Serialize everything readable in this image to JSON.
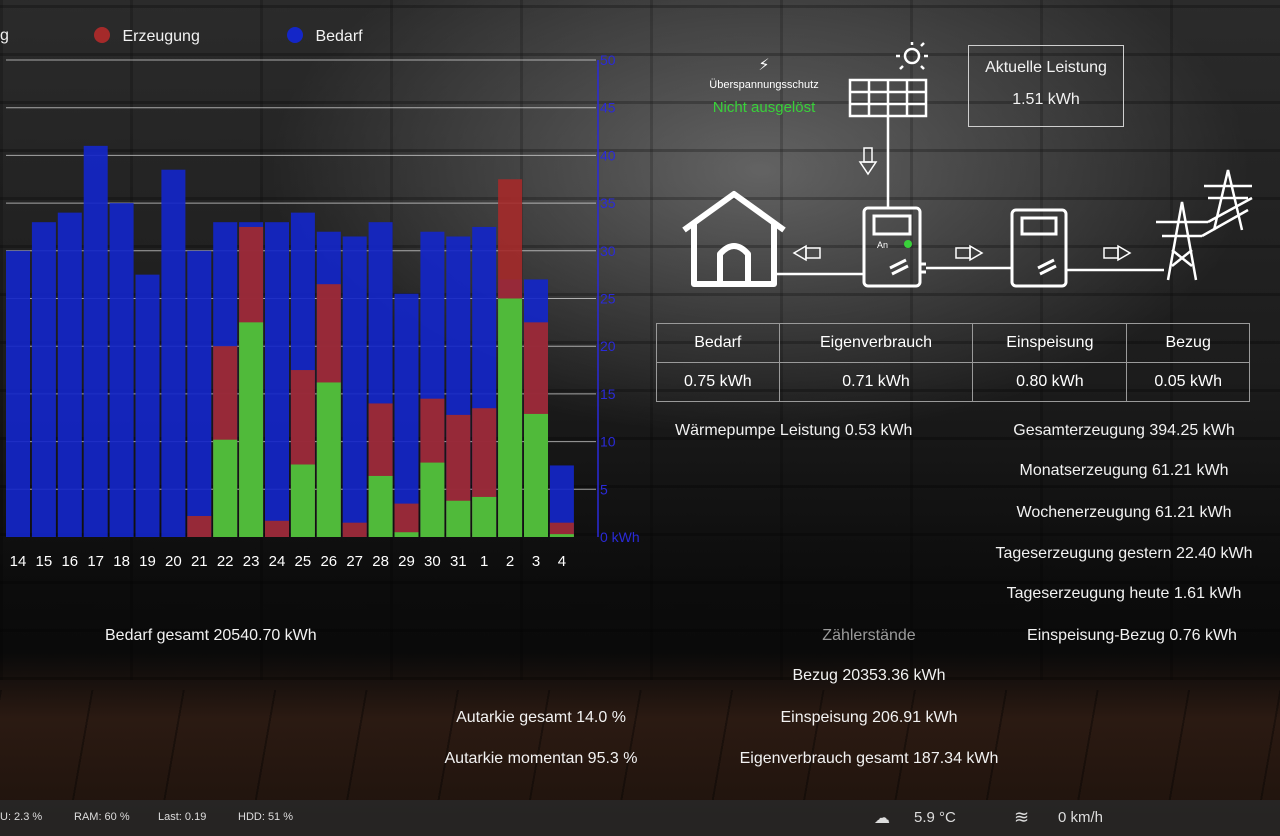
{
  "legend": [
    {
      "label": "g",
      "color": ""
    },
    {
      "label": "Erzeugung",
      "color": "#a52a2a"
    },
    {
      "label": "Bedarf",
      "color": "#1426c8"
    }
  ],
  "colors": {
    "bedarf": "#1426c8",
    "erzeugung": "#a52a2a",
    "eigen": "#4cc23a",
    "axis": "#2a2ad8"
  },
  "surge": {
    "title": "Überspannungsschutz",
    "status": "Nicht ausgelöst"
  },
  "aktuelle": {
    "title": "Aktuelle Leistung",
    "value": "1.51 kWh"
  },
  "stats": {
    "headers": [
      "Bedarf",
      "Eigenverbrauch",
      "Einspeisung",
      "Bezug"
    ],
    "values": [
      "0.75 kWh",
      "0.71 kWh",
      "0.80 kWh",
      "0.05 kWh"
    ]
  },
  "waermepumpe": "Wärmepumpe Leistung 0.53 kWh",
  "production": [
    "Gesamterzeugung 394.25 kWh",
    "Monatserzeugung 61.21 kWh",
    "Wochenerzeugung 61.21 kWh",
    "Tageserzeugung gestern 22.40 kWh",
    "Tageserzeugung heute 1.61 kWh",
    "Einspeisung-Bezug 0.76 kWh"
  ],
  "bedarf_gesamt": "Bedarf gesamt 20540.70 kWh",
  "zaehler": {
    "title": "Zählerstände",
    "bezug": "Bezug 20353.36 kWh",
    "einspeisung": "Einspeisung 206.91 kWh",
    "eigenverbrauch": "Eigenverbrauch gesamt 187.34 kWh"
  },
  "autarkie": {
    "gesamt": "Autarkie gesamt 14.0 %",
    "momentan": "Autarkie momentan 95.3 %"
  },
  "status": {
    "cpu": "U: 2.3 %",
    "ram": "RAM: 60 %",
    "last": "Last: 0.19",
    "hdd": "HDD: 51 %",
    "temp": "5.9 °C",
    "wind": "0 km/h"
  },
  "chart_data": {
    "type": "bar",
    "categories": [
      "14",
      "15",
      "16",
      "17",
      "18",
      "19",
      "20",
      "21",
      "22",
      "23",
      "24",
      "25",
      "26",
      "27",
      "28",
      "29",
      "30",
      "31",
      "1",
      "2",
      "3",
      "4"
    ],
    "series": [
      {
        "name": "Bedarf",
        "values": [
          30,
          33,
          34,
          41,
          35,
          27.5,
          38.5,
          30,
          33,
          33,
          33,
          34,
          32,
          31.5,
          33,
          25.5,
          32,
          31.5,
          32.5,
          27,
          27,
          7.5
        ]
      },
      {
        "name": "Erzeugung",
        "values": [
          0,
          0,
          0,
          0,
          0,
          0,
          0,
          2.2,
          20,
          32.5,
          1.7,
          17.5,
          26.5,
          1.5,
          14,
          3.5,
          14.5,
          12.8,
          13.5,
          37.5,
          22.5,
          1.5
        ]
      },
      {
        "name": "Eigenverbrauch",
        "values": [
          0,
          0,
          0,
          0,
          0,
          0,
          0,
          0,
          10.2,
          22.5,
          0,
          7.6,
          16.2,
          0,
          6.4,
          0.5,
          7.8,
          3.8,
          4.2,
          25,
          12.9,
          0.3
        ]
      }
    ],
    "ylabel": "kWh",
    "yticks": [
      0,
      5,
      10,
      15,
      20,
      25,
      30,
      35,
      40,
      45,
      50
    ],
    "ylim": [
      0,
      50
    ],
    "grid": true
  }
}
